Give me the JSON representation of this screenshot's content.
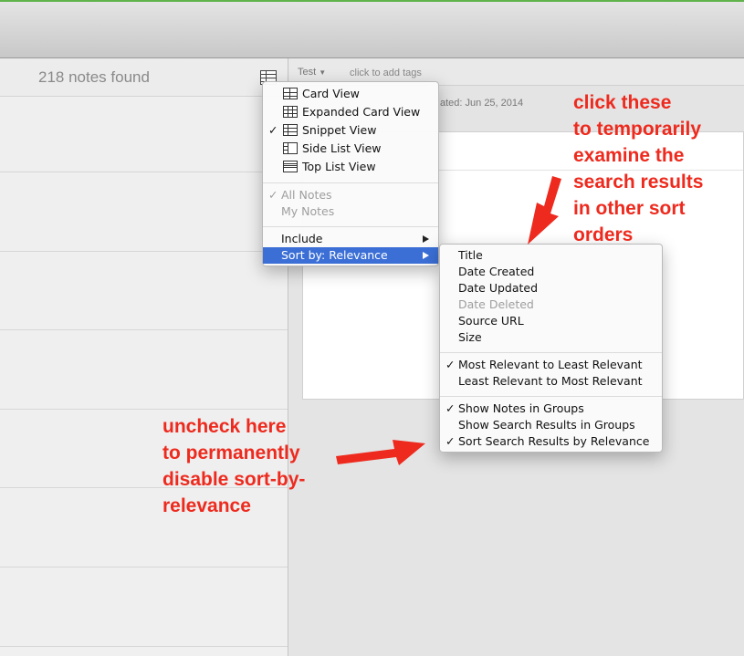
{
  "note_list": {
    "count_label": "218 notes found"
  },
  "editor": {
    "notebook": "Test",
    "add_tags": "click to add tags",
    "updated": "ated: Jun 25, 2014"
  },
  "view_menu": {
    "views": [
      {
        "label": "Card View",
        "checked": false,
        "icon": "card-view-icon"
      },
      {
        "label": "Expanded Card View",
        "checked": false,
        "icon": "expanded-card-view-icon"
      },
      {
        "label": "Snippet View",
        "checked": true,
        "icon": "snippet-view-icon"
      },
      {
        "label": "Side List View",
        "checked": false,
        "icon": "side-list-view-icon"
      },
      {
        "label": "Top List View",
        "checked": false,
        "icon": "top-list-view-icon"
      }
    ],
    "scope": [
      {
        "label": "All Notes",
        "checked": true,
        "disabled": true
      },
      {
        "label": "My Notes",
        "checked": false,
        "disabled": true
      }
    ],
    "include_label": "Include",
    "sort_by_label": "Sort by: Relevance",
    "check_mark": "✓"
  },
  "sort_submenu": {
    "fields": [
      {
        "label": "Title",
        "disabled": false
      },
      {
        "label": "Date Created",
        "disabled": false
      },
      {
        "label": "Date Updated",
        "disabled": false
      },
      {
        "label": "Date Deleted",
        "disabled": true
      },
      {
        "label": "Source URL",
        "disabled": false
      },
      {
        "label": "Size",
        "disabled": false
      }
    ],
    "order": [
      {
        "label": "Most Relevant to Least Relevant",
        "checked": true
      },
      {
        "label": "Least Relevant to Most Relevant",
        "checked": false
      }
    ],
    "options": [
      {
        "label": "Show Notes in Groups",
        "checked": true
      },
      {
        "label": "Show Search Results in Groups",
        "checked": false
      },
      {
        "label": "Sort Search Results by Relevance",
        "checked": true
      }
    ]
  },
  "annotations": {
    "top": "click these\nto temporarily\nexamine the\nsearch results\nin other sort\norders",
    "bottom": "uncheck here\nto permanently\ndisable sort-by-\nrelevance",
    "color": "#ee2a1e"
  },
  "colors": {
    "menu_highlight": "#3b6fd6",
    "window_accent": "#5fb34a"
  }
}
